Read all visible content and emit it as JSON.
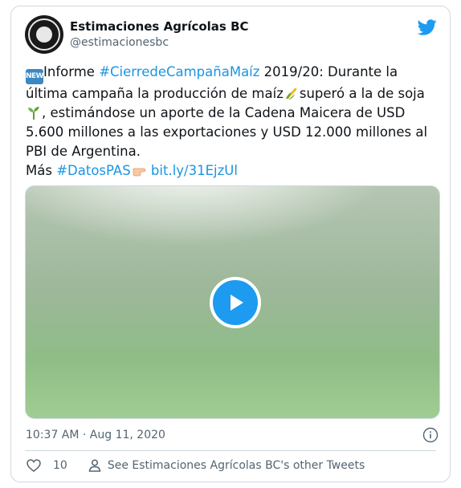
{
  "author": {
    "name": "Estimaciones Agrícolas BC",
    "handle": "@estimacionesbc"
  },
  "tweet": {
    "badge": "NEW",
    "p1": "Informe ",
    "hashtag1": "#CierredeCampañaMaíz",
    "p2": " 2019/20: Durante la última campaña la producción de maíz",
    "p3": "superó a la de soja",
    "p4": ", estimándose un aporte de la Cadena Maicera de USD 5.600 millones a las exportaciones y USD 12.000 millones al PBI de Argentina.",
    "p5": "Más ",
    "hashtag2": "#DatosPAS",
    "link": "bit.ly/31EjzUl"
  },
  "meta": {
    "timestamp": "10:37 AM · Aug 11, 2020"
  },
  "actions": {
    "likes": "10",
    "other_tweets": "See Estimaciones Agrícolas BC's other Tweets"
  },
  "icons": {
    "twitter": "twitter-bird-icon",
    "info": "info-icon",
    "heart": "heart-icon",
    "person": "person-icon",
    "play": "play-icon",
    "corn": "corn-emoji",
    "seedling": "seedling-emoji",
    "point": "pointing-hand-emoji"
  },
  "colors": {
    "link": "#1b95e0",
    "brand": "#1d9bf0",
    "muted": "#536471"
  }
}
